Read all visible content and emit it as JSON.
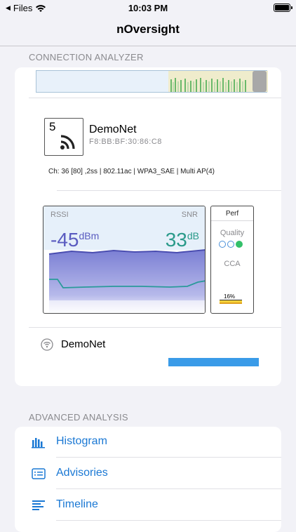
{
  "status_bar": {
    "back_app": "Files",
    "time": "10:03 PM"
  },
  "nav": {
    "title": "nOversight"
  },
  "connection_section": {
    "header": "CONNECTION ANALYZER",
    "network": {
      "channel_number": "5",
      "ssid": "DemoNet",
      "bssid": "F8:BB:BF:30:86:C8",
      "details": "Ch: 36  [80] ,2ss  | 802.11ac  | WPA3_SAE  | Multi AP(4)"
    },
    "meter": {
      "rssi_label": "RSSI",
      "snr_label": "SNR",
      "rssi_value": "-45",
      "rssi_unit": "dBm",
      "snr_value": "33",
      "snr_unit": "dB",
      "rssi_color": "#5a5cc0",
      "snr_color": "#2a9a8a"
    },
    "perf": {
      "title": "Perf",
      "quality_label": "Quality",
      "quality_dots": [
        false,
        false,
        true
      ],
      "cca_label": "CCA",
      "cca_percent": "16%",
      "cca_value": 0.16
    },
    "connected_row": {
      "ssid": "DemoNet"
    }
  },
  "advanced_section": {
    "header": "ADVANCED ANALYSIS",
    "items": [
      {
        "label": "Histogram",
        "icon": "histogram-icon"
      },
      {
        "label": "Advisories",
        "icon": "advisories-icon"
      },
      {
        "label": "Timeline",
        "icon": "timeline-icon"
      }
    ]
  },
  "colors": {
    "accent": "#1a78d4",
    "bar": "#3a9be8"
  }
}
